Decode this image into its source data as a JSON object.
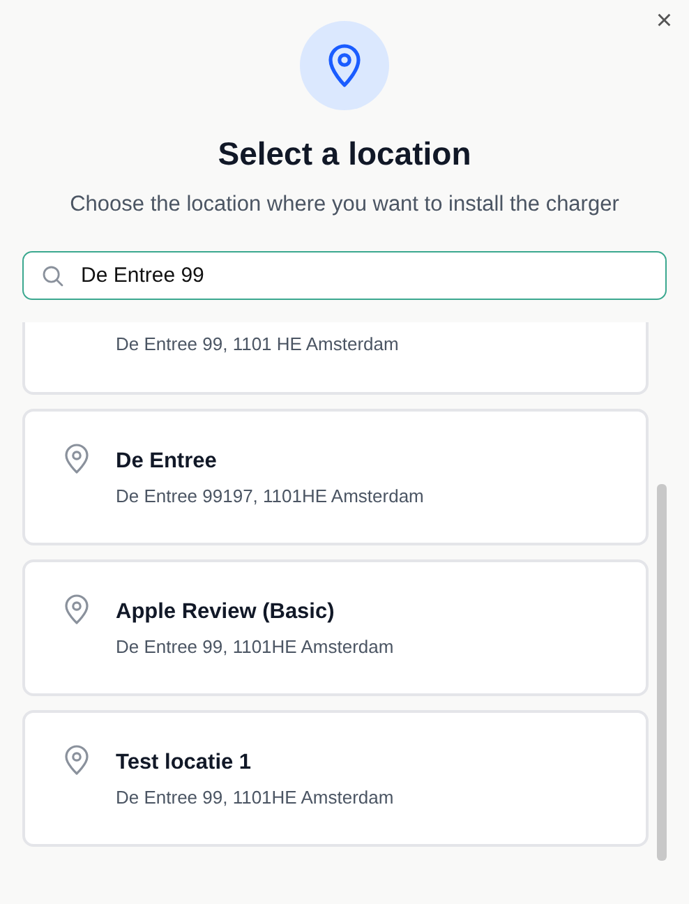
{
  "dialog": {
    "title": "Select a location",
    "subtitle": "Choose the location where you want to install the charger",
    "close_label": "×"
  },
  "search": {
    "value": "De Entree 99"
  },
  "locations": [
    {
      "address": "De Entree 99, 1101 HE Amsterdam"
    },
    {
      "name": "De Entree",
      "address": "De Entree 99197, 1101HE Amsterdam"
    },
    {
      "name": "Apple Review (Basic)",
      "address": "De Entree 99, 1101HE Amsterdam"
    },
    {
      "name": "Test locatie 1",
      "address": "De Entree 99, 1101HE Amsterdam"
    }
  ]
}
